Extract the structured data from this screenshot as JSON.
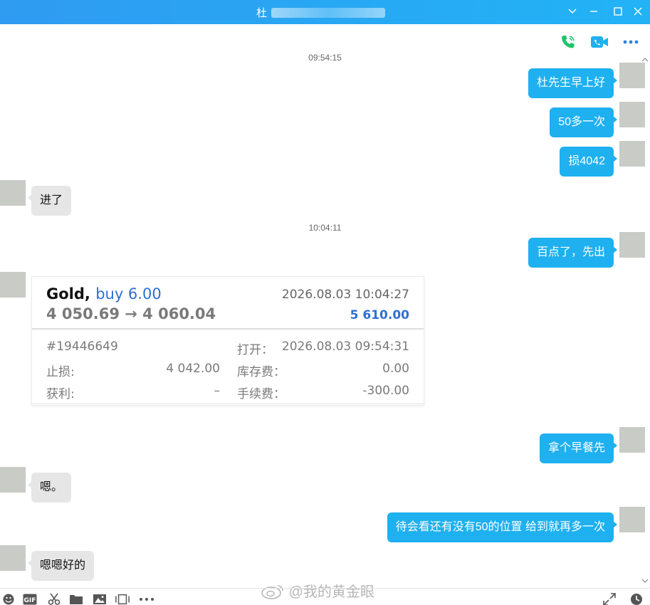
{
  "window": {
    "title": "杜"
  },
  "header_actions": [
    "phone-icon",
    "video-icon",
    "more-icon"
  ],
  "messages": {
    "t1": "09:54:15",
    "m1": "杜先生早上好",
    "m2": "50多一次",
    "m3": "损4042",
    "m4": "进了",
    "t2": "10:04:11",
    "m5": "百点了，先出",
    "m6": "拿个早餐先",
    "m7": "嗯。",
    "m8": "待会看还有没有50的位置 给到就再多一次",
    "m9": "嗯嗯好的"
  },
  "trade_card": {
    "symbol": "Gold,",
    "side": "buy 6.00",
    "close_time": "2026.08.03 10:04:27",
    "price_move": "4 050.69 → 4 060.04",
    "profit": "5 610.00",
    "order_id": "#19446649",
    "open_label": "打开：",
    "open_time": "2026.08.03 09:54:31",
    "sl_label": "止损:",
    "sl_value": "4 042.00",
    "swap_label": "库存费：",
    "swap_value": "0.00",
    "tp_label": "获利:",
    "tp_value": "–",
    "commission_label": "手续费：",
    "commission_value": "-300.00"
  },
  "toolbar": {
    "icons": [
      "emoji-icon",
      "gif-icon",
      "scissors-icon",
      "folder-icon",
      "image-icon",
      "screen-record-icon",
      "more-icon",
      "expand-icon",
      "history-icon"
    ]
  },
  "watermark": "@我的黄金眼",
  "colors": {
    "titlebar": "#2f9bf1",
    "bubble_self": "#1fb0f0",
    "bubble_other": "#e6e6e6",
    "accent_blue": "#2f6fd0",
    "phone_green": "#1fc46a"
  }
}
